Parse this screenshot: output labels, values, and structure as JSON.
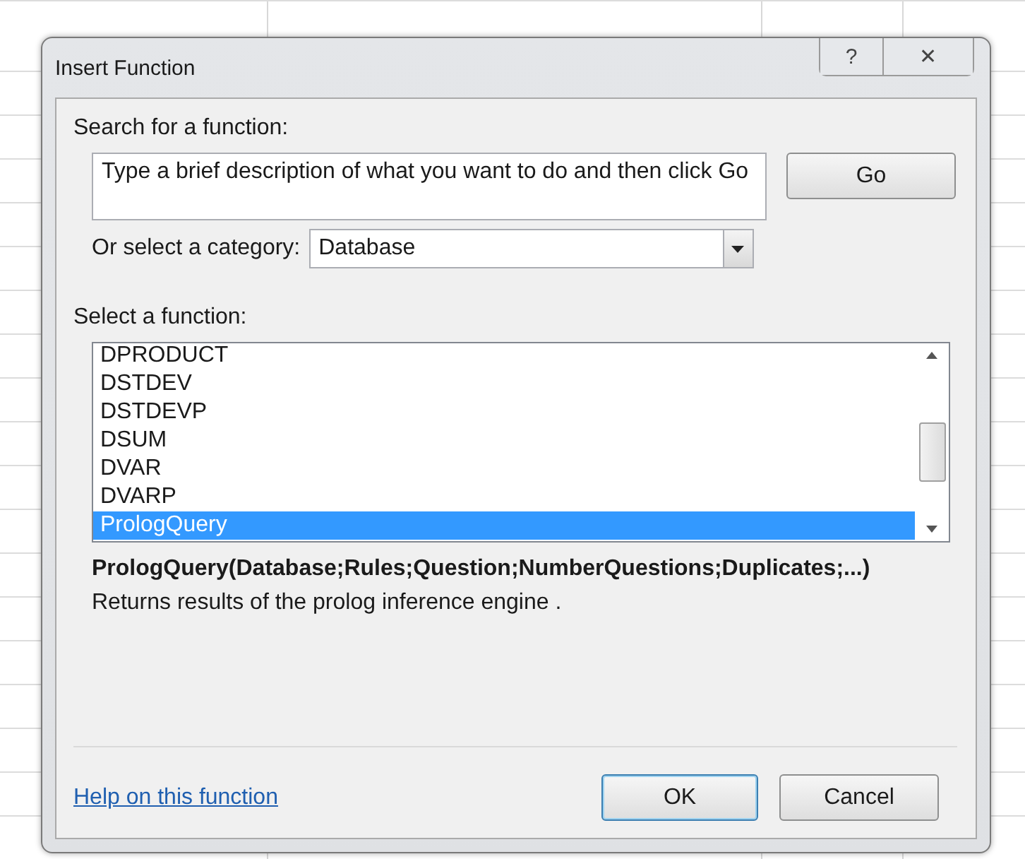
{
  "window": {
    "title": "Insert Function",
    "help_button": "?",
    "close_button": "✕"
  },
  "search": {
    "label": "Search for a function:",
    "value": "Type a brief description of what you want to do and then click Go",
    "go_button": "Go"
  },
  "category": {
    "label": "Or select a category:",
    "value": "Database"
  },
  "functions": {
    "label": "Select a function:",
    "items": [
      {
        "name": "DPRODUCT",
        "selected": false
      },
      {
        "name": "DSTDEV",
        "selected": false
      },
      {
        "name": "DSTDEVP",
        "selected": false
      },
      {
        "name": "DSUM",
        "selected": false
      },
      {
        "name": "DVAR",
        "selected": false
      },
      {
        "name": "DVARP",
        "selected": false
      },
      {
        "name": "PrologQuery",
        "selected": true
      }
    ]
  },
  "signature": "PrologQuery(Database;Rules;Question;NumberQuestions;Duplicates;...)",
  "description": "Returns results of the prolog inference engine .",
  "help_link": "Help on this function",
  "buttons": [
    {
      "label": "OK",
      "default": true
    },
    {
      "label": "Cancel",
      "default": false
    }
  ]
}
